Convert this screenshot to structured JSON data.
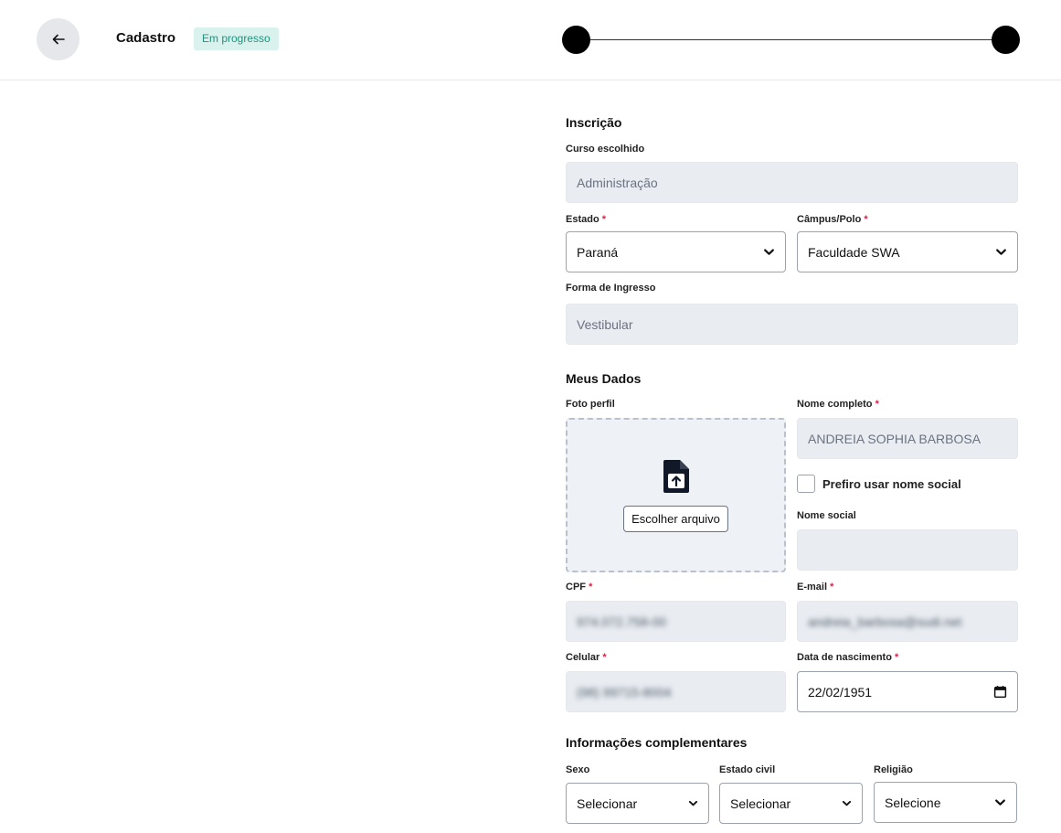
{
  "header": {
    "title": "Cadastro",
    "status_badge": "Em progresso"
  },
  "inscricao": {
    "section_title": "Inscrição",
    "curso_label": "Curso escolhido",
    "curso_value": "Administração",
    "estado_label": "Estado",
    "estado_value": "Paraná",
    "campus_label": "Câmpus/Polo",
    "campus_value": "Faculdade SWA",
    "forma_label": "Forma de Ingresso",
    "forma_value": "Vestibular",
    "required_mark": "*"
  },
  "meus_dados": {
    "section_title": "Meus Dados",
    "foto_label": "Foto perfil",
    "upload_button": "Escolher arquivo",
    "nome_label": "Nome completo",
    "nome_value": "ANDREIA SOPHIA BARBOSA",
    "nome_social_checkbox": "Prefiro usar nome social",
    "nome_social_label": "Nome social",
    "nome_social_value": "",
    "cpf_label": "CPF",
    "cpf_value": "974.072.758-00",
    "email_label": "E-mail",
    "email_value": "andreia_barbosa@sudi.net",
    "celular_label": "Celular",
    "celular_value": "(98) 99715-8004",
    "nascimento_label": "Data de nascimento",
    "nascimento_value": "22/02/1951"
  },
  "complementares": {
    "section_title": "Informações complementares",
    "sexo_label": "Sexo",
    "sexo_value": "Selecionar",
    "estado_civil_label": "Estado civil",
    "estado_civil_value": "Selecionar",
    "religiao_label": "Religião",
    "religiao_value": "Selecione"
  },
  "icons": {
    "back": "arrow-left-icon",
    "chevron": "chevron-down-icon",
    "upload": "file-upload-icon",
    "calendar": "calendar-icon"
  },
  "colors": {
    "badge_bg": "#d9f2ee",
    "badge_text": "#21927c",
    "required": "#e11d48",
    "disabled_field": "#e9edf2",
    "step_dot": "#000000"
  }
}
